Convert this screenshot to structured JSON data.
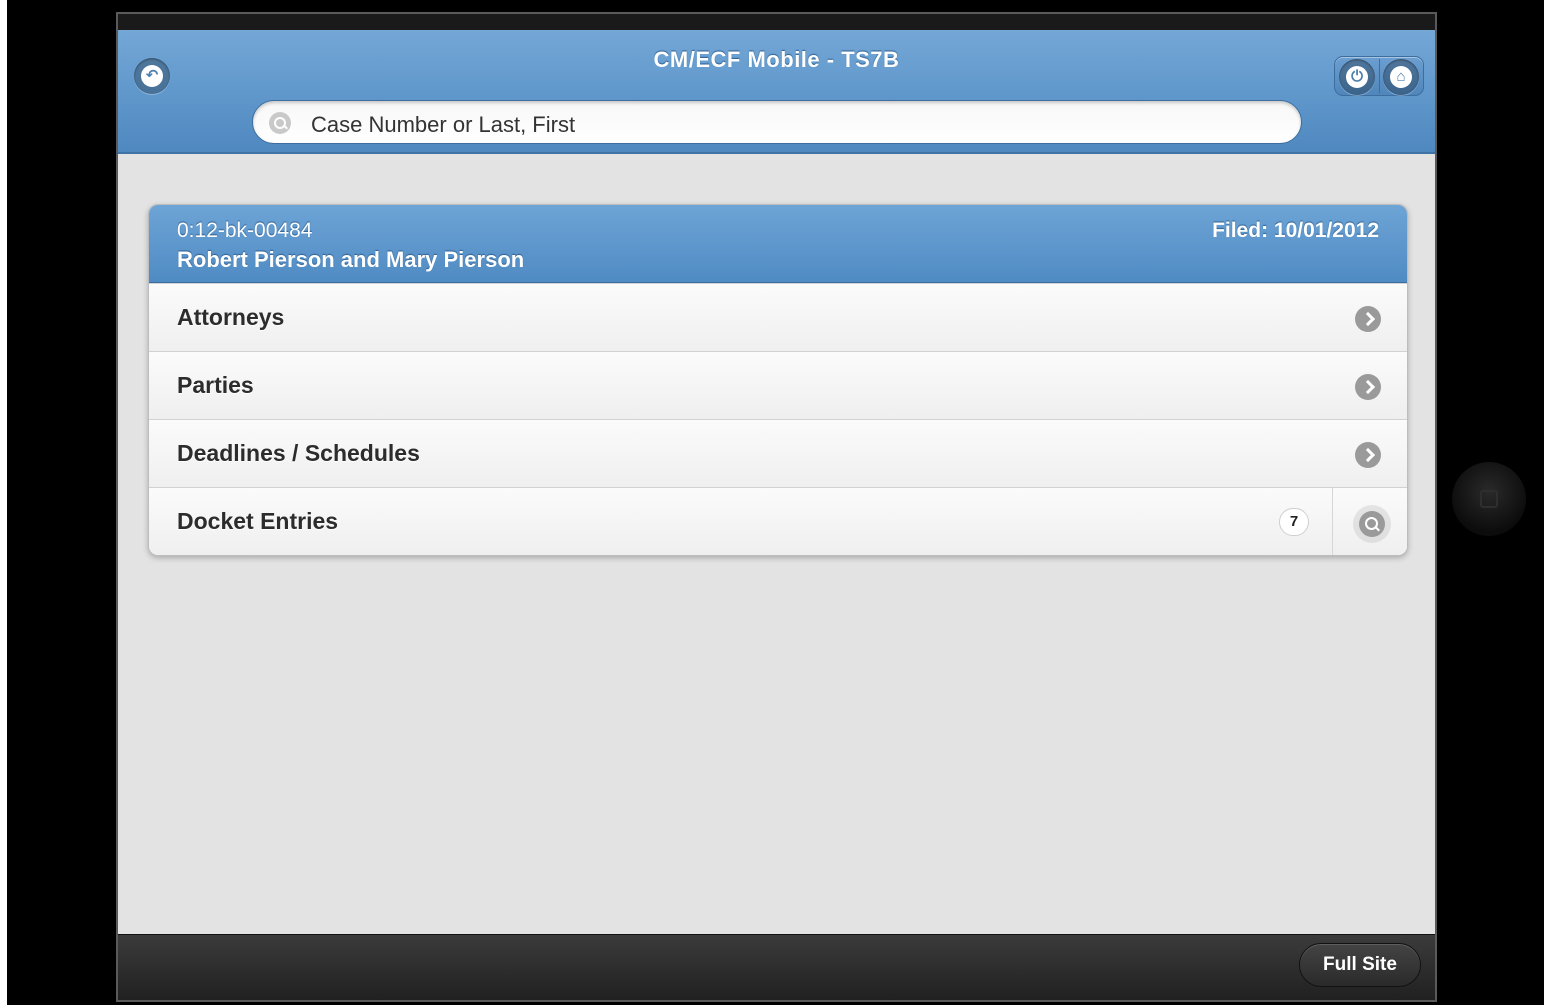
{
  "header": {
    "title": "CM/ECF Mobile - TS7B"
  },
  "search": {
    "placeholder": "Case Number or Last, First"
  },
  "case": {
    "number": "0:12-bk-00484",
    "parties": "Robert Pierson and Mary Pierson",
    "filed": "Filed: 10/01/2012"
  },
  "menu": {
    "items": [
      {
        "label": "Attorneys"
      },
      {
        "label": "Parties"
      },
      {
        "label": "Deadlines / Schedules"
      },
      {
        "label": "Docket Entries",
        "count": "7"
      }
    ]
  },
  "footer": {
    "full_site_label": "Full Site"
  },
  "icons": {
    "back": "back-arrow-icon",
    "power": "power-icon",
    "home": "home-icon",
    "search": "search-icon",
    "row_arrow": "chevron-right-icon",
    "row_search": "search-icon"
  },
  "colors": {
    "header_blue": "#5f97cb",
    "background": "#e3e3e3",
    "footer": "#2a2a2a"
  }
}
